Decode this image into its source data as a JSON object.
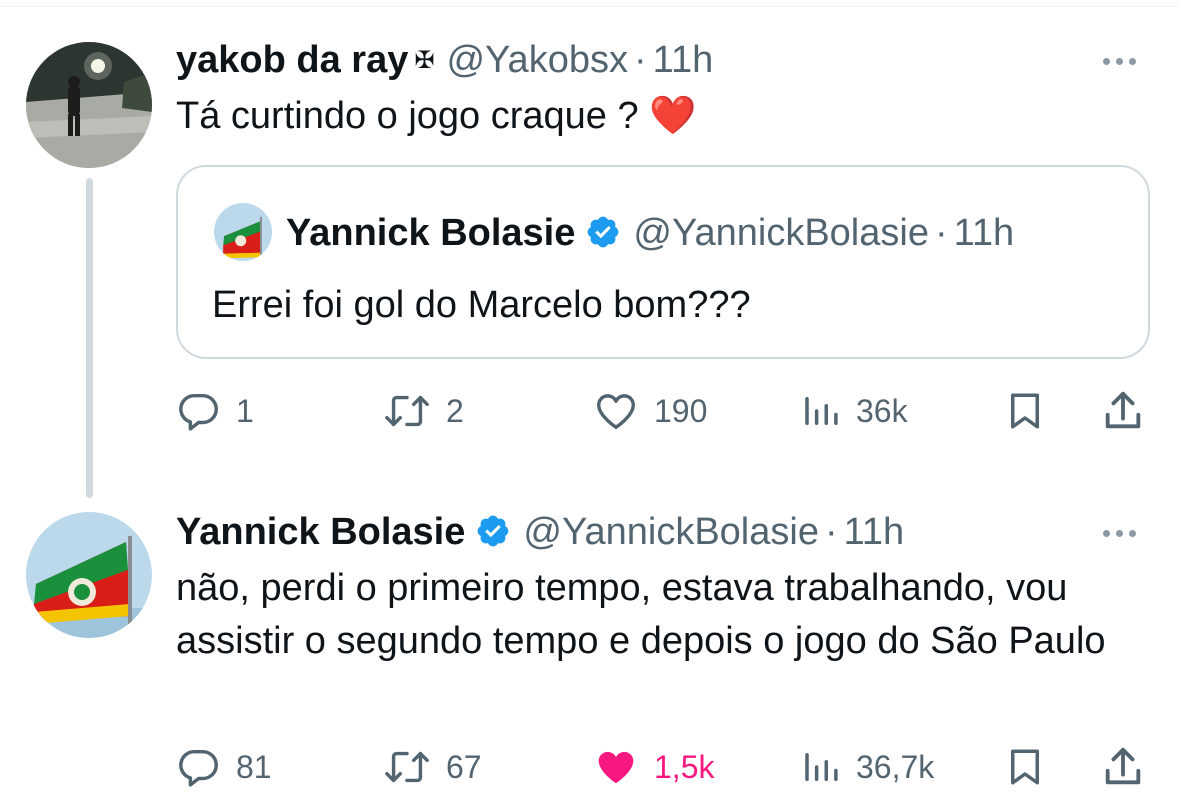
{
  "reply": {
    "name": "yakob da ray",
    "cross_symbol": "✠",
    "handle": "@Yakobsx",
    "dot": "·",
    "time": "11h",
    "text": "Tá curtindo o jogo craque ? ❤️",
    "quote": {
      "name": "Yannick Bolasie",
      "handle": "@YannickBolasie",
      "dot": "·",
      "time": "11h",
      "text": "Errei foi gol do Marcelo bom???"
    },
    "actions": {
      "replies": "1",
      "retweets": "2",
      "likes": "190",
      "views": "36k"
    }
  },
  "main": {
    "name": "Yannick Bolasie",
    "handle": "@YannickBolasie",
    "dot": "·",
    "time": "11h",
    "text": "não, perdi o primeiro tempo, estava trabalhando, vou assistir o segundo tempo e depois o jogo do São Paulo",
    "actions": {
      "replies": "81",
      "retweets": "67",
      "likes": "1,5k",
      "liked": true,
      "views": "36,7k"
    }
  },
  "colors": {
    "text": "#0f1419",
    "secondary": "#536471",
    "verified": "#1d9bf0",
    "like_active": "#f91880",
    "border": "#cfd9de"
  }
}
